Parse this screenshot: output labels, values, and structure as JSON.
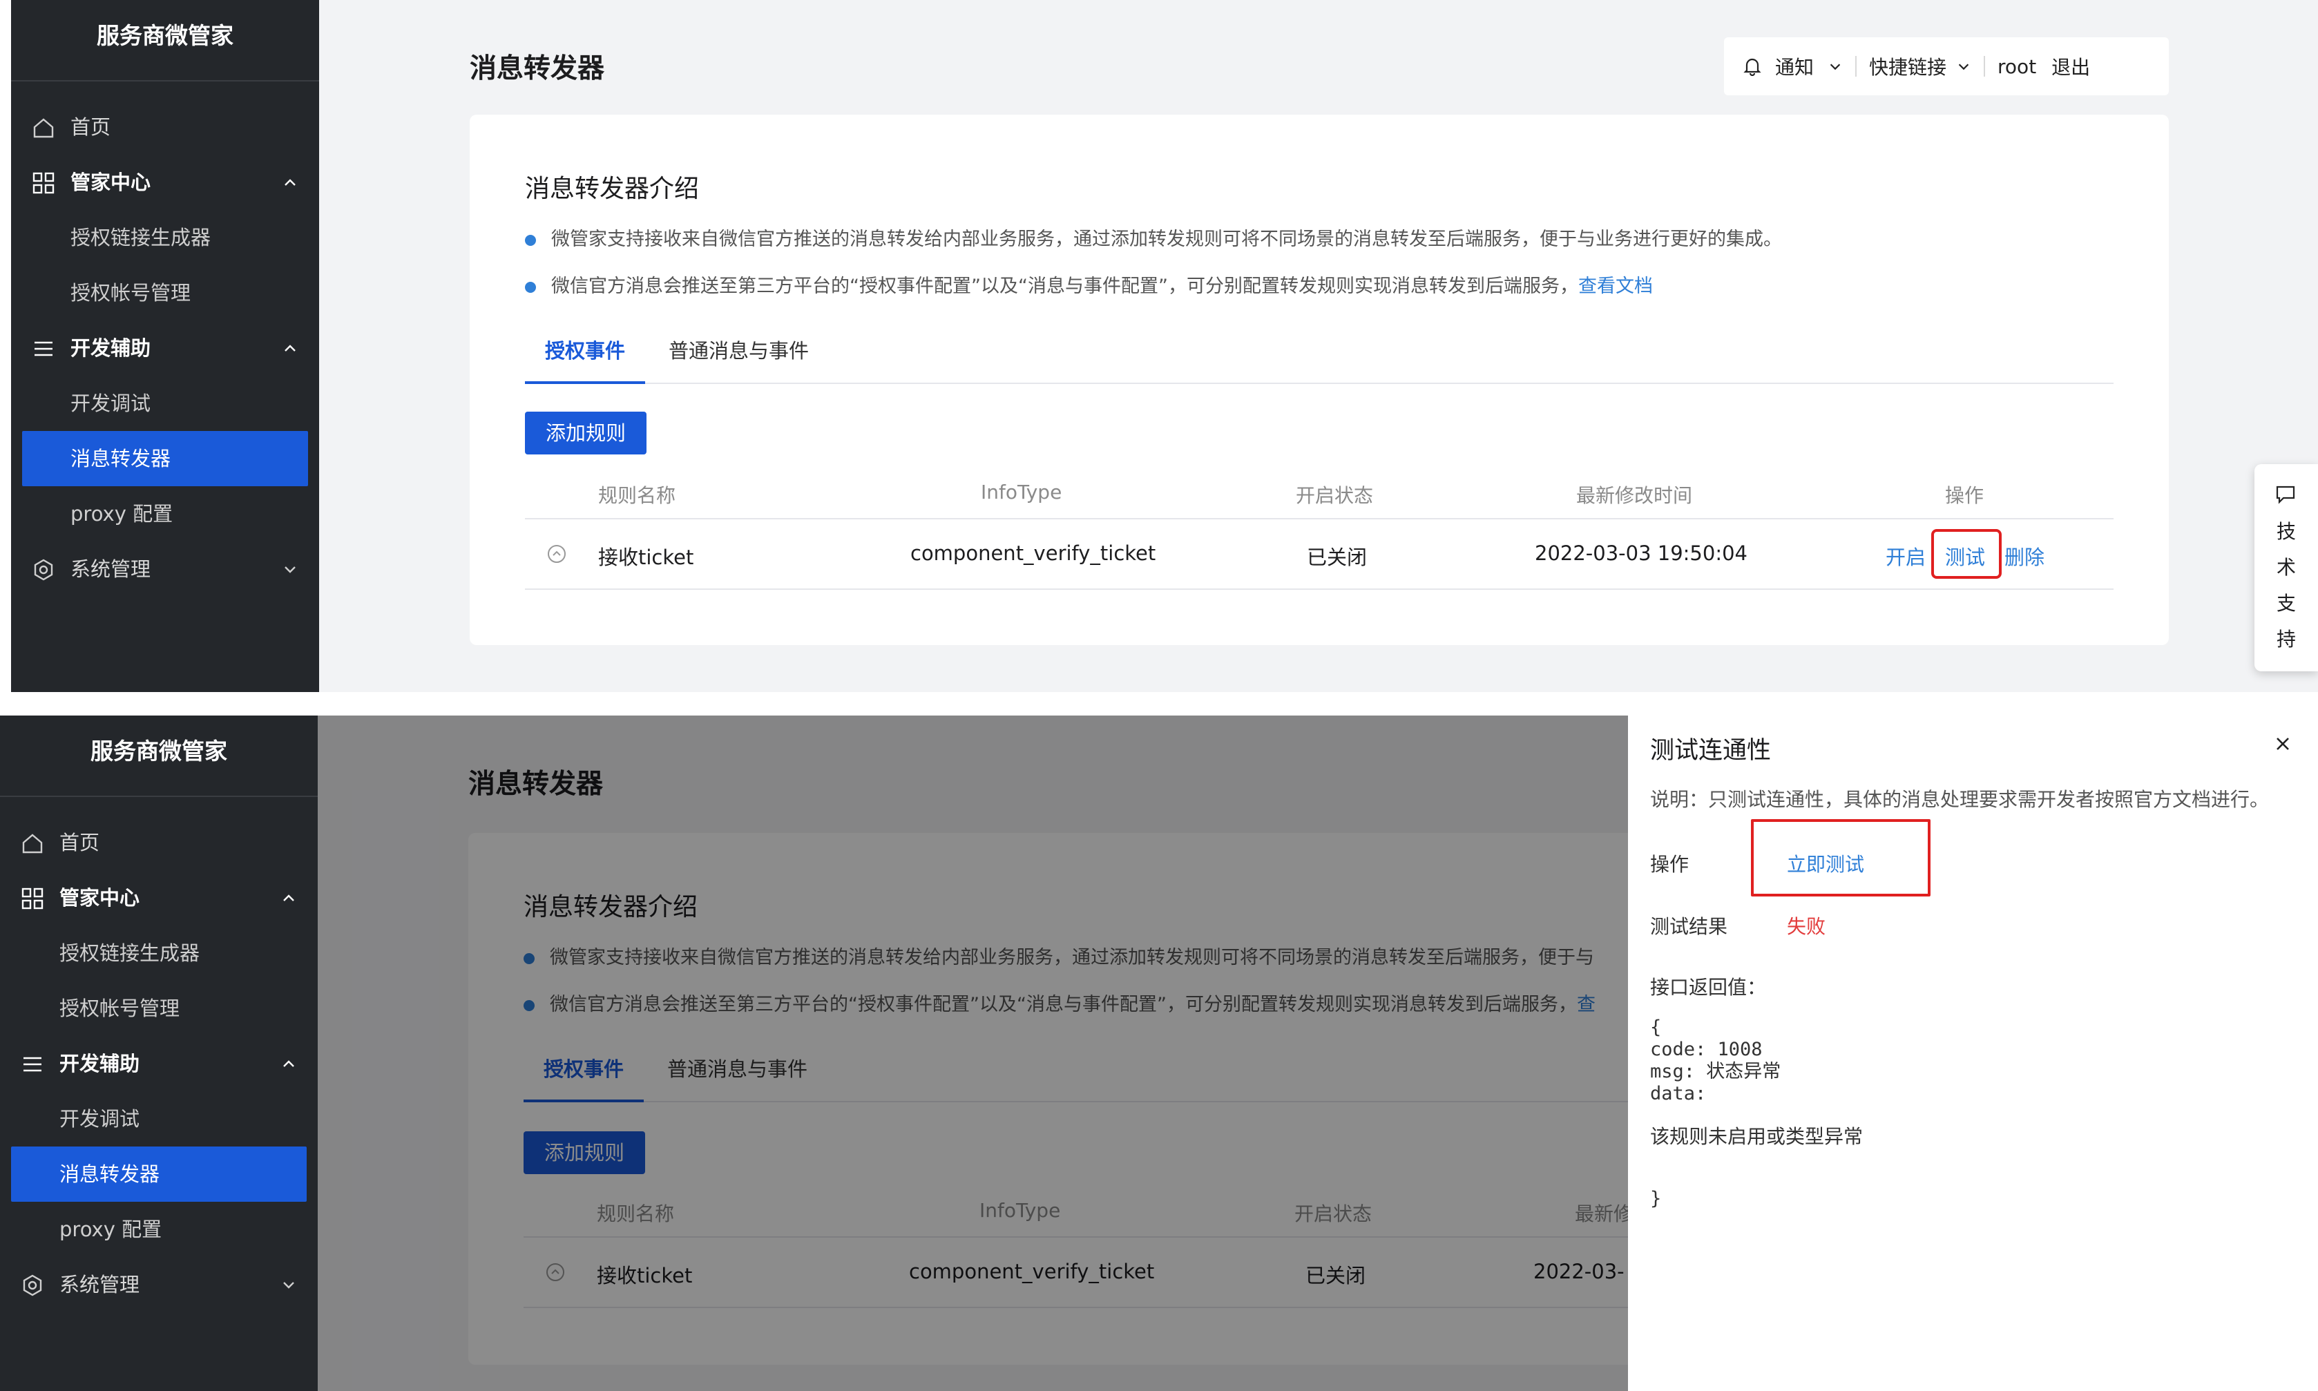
{
  "app": {
    "brand": "服务商微管家"
  },
  "sidebar": {
    "items": [
      {
        "label": "首页",
        "icon": "home-icon"
      },
      {
        "label": "管家中心",
        "icon": "grid-icon",
        "group": true
      },
      {
        "label": "授权链接生成器"
      },
      {
        "label": "授权帐号管理"
      },
      {
        "label": "开发辅助",
        "icon": "list-icon",
        "group": true
      },
      {
        "label": "开发调试"
      },
      {
        "label": "消息转发器",
        "active": true
      },
      {
        "label": "proxy 配置"
      },
      {
        "label": "系统管理",
        "icon": "settings-icon"
      }
    ]
  },
  "header": {
    "page_title": "消息转发器",
    "notify_label": "通知",
    "quick_links_label": "快捷链接",
    "user": "root",
    "logout_label": "退出"
  },
  "intro": {
    "title": "消息转发器介绍",
    "bullet1": "微管家支持接收来自微信官方推送的消息转发给内部业务服务，通过添加转发规则可将不同场景的消息转发至后端服务，便于与业务进行更好的集成。",
    "bullet2": "微信官方消息会推送至第三方平台的“授权事件配置”以及“消息与事件配置”，可分别配置转发规则实现消息转发到后端服务，",
    "bullet2_link": "查看文档",
    "bullet1_cut": "微管家支持接收来自微信官方推送的消息转发给内部业务服务，通过添加转发规则可将不同场景的消息转发至后端服务，便于与",
    "bullet2_cut": "微信官方消息会推送至第三方平台的“授权事件配置”以及“消息与事件配置”，可分别配置转发规则实现消息转发到后端服务，",
    "bullet2_link_cut": "查"
  },
  "tabs": [
    {
      "label": "授权事件",
      "active": true
    },
    {
      "label": "普通消息与事件"
    }
  ],
  "add_rule_label": "添加规则",
  "table": {
    "headers": [
      "规则名称",
      "InfoType",
      "开启状态",
      "最新修改时间",
      "操作"
    ],
    "rows": [
      {
        "name": "接收ticket",
        "info_type": "component_verify_ticket",
        "status": "已关闭",
        "modified": "2022-03-03 19:50:04",
        "modified_cut": "2022-03-",
        "header_modified_cut": "最新修"
      }
    ],
    "actions": {
      "enable": "开启",
      "test": "测试",
      "delete": "删除"
    }
  },
  "support": {
    "label": "技术支持",
    "chars": [
      "技",
      "术",
      "支",
      "持"
    ]
  },
  "drawer": {
    "title": "测试连通性",
    "note": "说明：只测试连通性，具体的消息处理要求需开发者按照官方文档进行。",
    "op_label": "操作",
    "test_now_label": "立即测试",
    "result_label": "测试结果",
    "result_value": "失败",
    "return_label": "接口返回值：",
    "code_block": "{\ncode: 1008\nmsg: 状态异常\ndata:",
    "data_message": "该规则未启用或类型异常",
    "closing_brace": "}"
  },
  "colors": {
    "primary": "#1a5ad9",
    "sidebar_bg": "#24272b",
    "link": "#2f7fd7",
    "error": "#e02020",
    "fail_text": "#e23b3b"
  }
}
